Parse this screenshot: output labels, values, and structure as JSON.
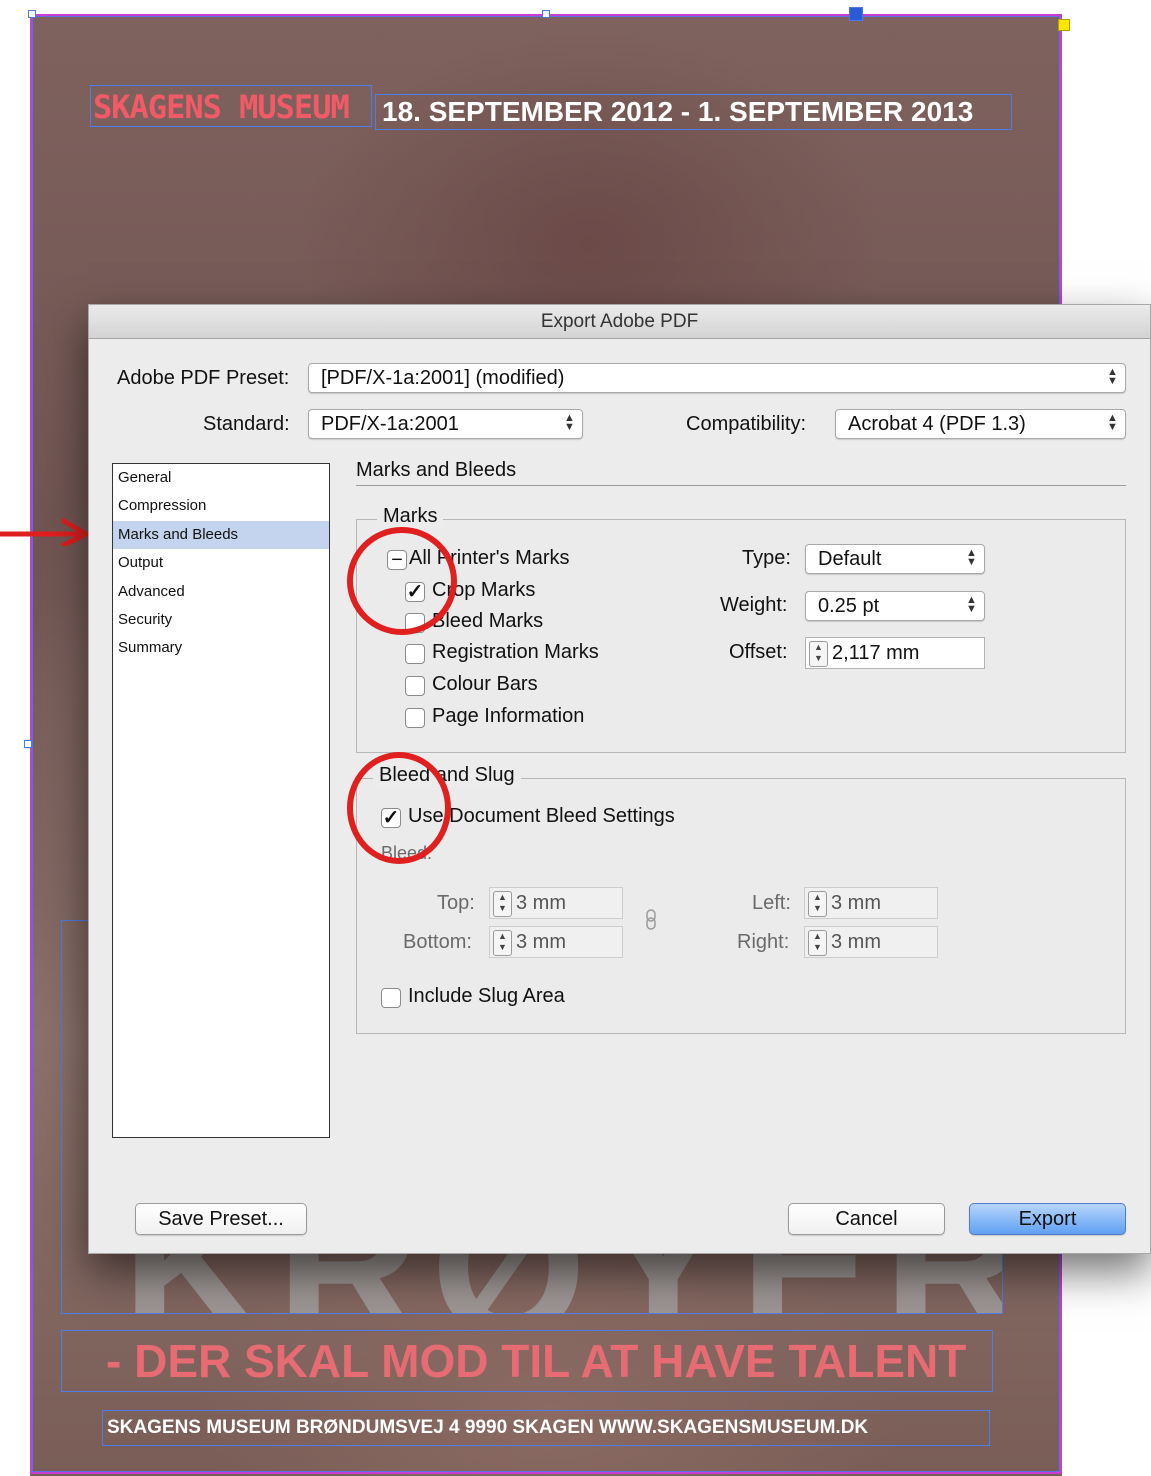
{
  "poster": {
    "logo": "SKAGENS MUSEUM",
    "dates": "18. SEPTEMBER 2012 - 1. SEPTEMBER 2013",
    "big_title": "KRØYER",
    "tagline": "- DER SKAL MOD TIL AT HAVE TALENT",
    "address": "SKAGENS MUSEUM  BRØNDUMSVEJ 4  9990 SKAGEN  WWW.SKAGENSMUSEUM.DK"
  },
  "dialog": {
    "title": "Export Adobe PDF",
    "preset": {
      "label": "Adobe PDF Preset:",
      "value": "[PDF/X-1a:2001] (modified)"
    },
    "standard": {
      "label": "Standard:",
      "value": "PDF/X-1a:2001"
    },
    "compatibility": {
      "label": "Compatibility:",
      "value": "Acrobat 4 (PDF 1.3)"
    },
    "sidebar": {
      "items": [
        {
          "label": "General",
          "selected": false
        },
        {
          "label": "Compression",
          "selected": false
        },
        {
          "label": "Marks and Bleeds",
          "selected": true
        },
        {
          "label": "Output",
          "selected": false
        },
        {
          "label": "Advanced",
          "selected": false
        },
        {
          "label": "Security",
          "selected": false
        },
        {
          "label": "Summary",
          "selected": false
        }
      ]
    },
    "section_title": "Marks and Bleeds",
    "marks": {
      "legend": "Marks",
      "all_printers_marks": {
        "label": "All Printer's Marks",
        "state": "mixed"
      },
      "crop_marks": {
        "label": "Crop Marks",
        "checked": true
      },
      "bleed_marks": {
        "label": "Bleed Marks",
        "checked": false
      },
      "registration_marks": {
        "label": "Registration Marks",
        "checked": false
      },
      "colour_bars": {
        "label": "Colour Bars",
        "checked": false
      },
      "page_information": {
        "label": "Page Information",
        "checked": false
      },
      "type": {
        "label": "Type:",
        "value": "Default"
      },
      "weight": {
        "label": "Weight:",
        "value": "0.25 pt"
      },
      "offset": {
        "label": "Offset:",
        "value": "2,117 mm"
      }
    },
    "bleed_slug": {
      "legend": "Bleed and Slug",
      "use_document_bleed": {
        "label": "Use Document Bleed Settings",
        "checked": true
      },
      "bleed_label": "Bleed:",
      "top": {
        "label": "Top:",
        "value": "3 mm"
      },
      "bottom": {
        "label": "Bottom:",
        "value": "3 mm"
      },
      "left": {
        "label": "Left:",
        "value": "3 mm"
      },
      "right": {
        "label": "Right:",
        "value": "3 mm"
      },
      "include_slug": {
        "label": "Include Slug Area",
        "checked": false
      }
    },
    "buttons": {
      "save_preset": "Save Preset...",
      "cancel": "Cancel",
      "export": "Export"
    }
  },
  "colors": {
    "annotation_red": "#e01f1f",
    "selection_blue": "#c4d4ee",
    "export_button": "#5fa0f3"
  },
  "icons": {
    "check": "✓",
    "mixed": "−",
    "chain": "chain-link-icon"
  }
}
